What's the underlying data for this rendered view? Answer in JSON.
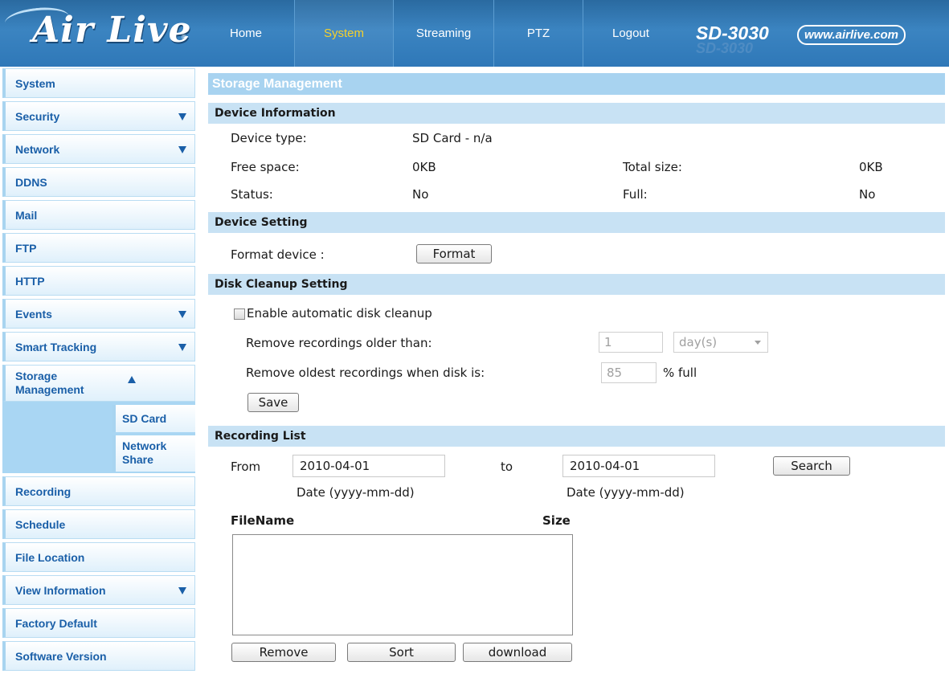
{
  "header": {
    "brand": "Air Live",
    "model": "SD-3030",
    "website": "www.airlive.com",
    "tabs": [
      {
        "label": "Home"
      },
      {
        "label": "System"
      },
      {
        "label": "Streaming"
      },
      {
        "label": "PTZ"
      },
      {
        "label": "Logout"
      }
    ],
    "active_tab": "System"
  },
  "sidebar": {
    "items": [
      {
        "label": "System"
      },
      {
        "label": "Security"
      },
      {
        "label": "Network"
      },
      {
        "label": "DDNS"
      },
      {
        "label": "Mail"
      },
      {
        "label": "FTP"
      },
      {
        "label": "HTTP"
      },
      {
        "label": "Events"
      },
      {
        "label": "Smart Tracking"
      },
      {
        "label": "Storage Management"
      },
      {
        "label": "Recording"
      },
      {
        "label": "Schedule"
      },
      {
        "label": "File Location"
      },
      {
        "label": "View Information"
      },
      {
        "label": "Factory Default"
      },
      {
        "label": "Software Version"
      }
    ],
    "storage_sub": [
      {
        "label": "SD Card"
      },
      {
        "label": "Network Share"
      }
    ]
  },
  "page": {
    "title": "Storage Management",
    "device_info": {
      "heading": "Device Information",
      "device_type_label": "Device type:",
      "device_type_value": "SD Card - n/a",
      "free_space_label": "Free space:",
      "free_space_value": "0KB",
      "total_size_label": "Total size:",
      "total_size_value": "0KB",
      "status_label": "Status:",
      "status_value": "No",
      "full_label": "Full:",
      "full_value": "No"
    },
    "device_setting": {
      "heading": "Device Setting",
      "format_label": "Format device :",
      "format_button": "Format"
    },
    "disk_cleanup": {
      "heading": "Disk Cleanup Setting",
      "enable_label": "Enable automatic disk cleanup",
      "enable_checked": false,
      "older_label": "Remove recordings older than:",
      "older_value": "1",
      "older_unit": "day(s)",
      "oldest_label": "Remove oldest recordings when disk is:",
      "oldest_value": "85",
      "oldest_suffix": "% full",
      "save_button": "Save"
    },
    "recording_list": {
      "heading": "Recording List",
      "from_label": "From",
      "from_value": "2010-04-01",
      "to_label": "to",
      "to_value": "2010-04-01",
      "search_button": "Search",
      "from_hint": "Date (yyyy-mm-dd)",
      "to_hint": "Date (yyyy-mm-dd)",
      "col_filename": "FileName",
      "col_size": "Size",
      "remove_button": "Remove",
      "sort_button": "Sort",
      "download_button": "download"
    }
  }
}
